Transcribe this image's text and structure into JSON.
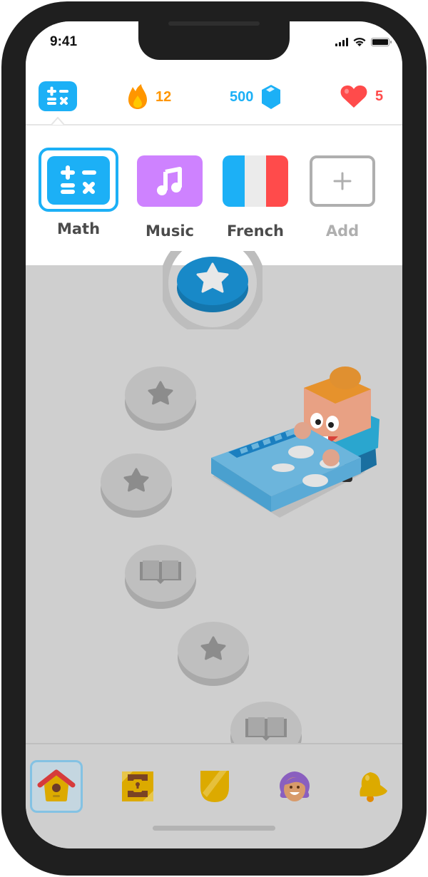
{
  "status_bar": {
    "time": "9:41",
    "icons": [
      "cellular-signal-icon",
      "wifi-icon",
      "battery-icon"
    ]
  },
  "stats": {
    "current_course_icon": "math-symbols-icon",
    "streak": {
      "icon": "flame-icon",
      "value": "12",
      "color": "#ff9600"
    },
    "gems": {
      "icon": "gem-icon",
      "value": "500",
      "color": "#1cb0f6"
    },
    "hearts": {
      "icon": "heart-icon",
      "value": "5",
      "color": "#ff4b4b"
    }
  },
  "courses": [
    {
      "label": "Math",
      "icon": "math-symbols-icon",
      "color": "#1cb0f6",
      "selected": true
    },
    {
      "label": "Music",
      "icon": "music-note-icon",
      "color": "#ce82ff",
      "selected": false
    },
    {
      "label": "French",
      "icon": "france-flag-icon",
      "colors": [
        "#1cb0f6",
        "#ebebeb",
        "#ff4b4b"
      ],
      "selected": false
    },
    {
      "label": "Add",
      "icon": "plus-icon",
      "color": "#afafaf",
      "selected": false
    }
  ],
  "path": {
    "nodes": [
      {
        "type": "star",
        "state": "current"
      },
      {
        "type": "star",
        "state": "locked"
      },
      {
        "type": "star",
        "state": "locked"
      },
      {
        "type": "book",
        "state": "locked"
      },
      {
        "type": "star",
        "state": "locked"
      },
      {
        "type": "book",
        "state": "locked"
      }
    ],
    "illustration": "character-with-calculator"
  },
  "tabbar": {
    "items": [
      {
        "name": "home",
        "icon": "birdhouse-icon",
        "active": true
      },
      {
        "name": "chest",
        "icon": "treasure-chest-icon",
        "active": false
      },
      {
        "name": "leagues",
        "icon": "shield-icon",
        "active": false
      },
      {
        "name": "profile",
        "icon": "avatar-icon",
        "active": false
      },
      {
        "name": "notifications",
        "icon": "bell-icon",
        "active": false
      }
    ]
  },
  "colors": {
    "accent": "#1cb0f6",
    "overlay": "#cfcfcf",
    "text": "#4b4b4b"
  }
}
